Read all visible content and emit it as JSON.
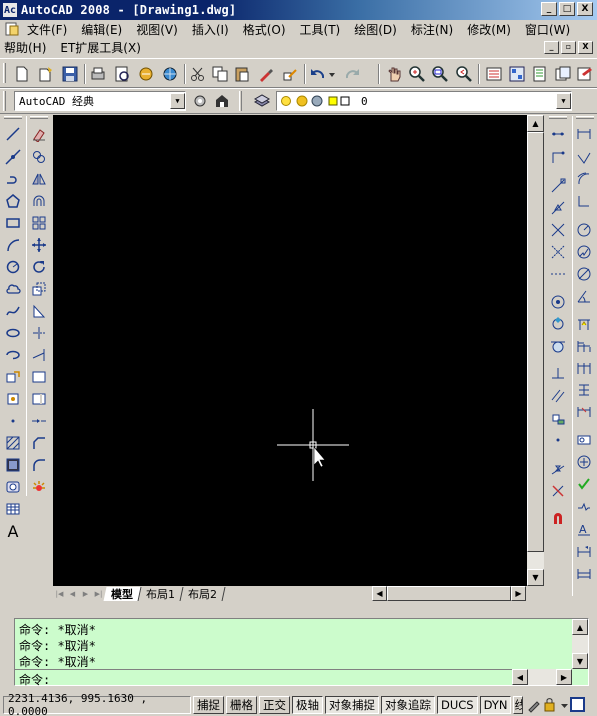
{
  "window": {
    "title": "AutoCAD 2008 - [Drawing1.dwg]",
    "app_icon_text": "Ac",
    "controls": [
      "_",
      "□",
      "X"
    ]
  },
  "menubar": {
    "items": [
      "文件(F)",
      "编辑(E)",
      "视图(V)",
      "插入(I)",
      "格式(O)",
      "工具(T)",
      "绘图(D)",
      "标注(N)",
      "修改(M)",
      "窗口(W)"
    ],
    "items_row2": [
      "帮助(H)",
      "ET扩展工具(X)"
    ],
    "mdi_controls": [
      "_",
      "▫",
      "X"
    ]
  },
  "workspace": {
    "selected": "AutoCAD 经典"
  },
  "layer": {
    "current": "0"
  },
  "layout_tabs": {
    "tabs": [
      "模型",
      "布局1",
      "布局2"
    ],
    "active": "模型"
  },
  "command": {
    "history": [
      "命令: *取消*",
      "命令: *取消*",
      "命令: *取消*"
    ],
    "prompt": "命令:"
  },
  "status": {
    "coordinates": "2231.4136, 995.1630 , 0.0000",
    "toggles": [
      "捕捉",
      "栅格",
      "正交",
      "极轴",
      "对象捕捉",
      "对象追踪",
      "DUCS",
      "DYN",
      "线"
    ]
  },
  "colors": {
    "title_start": "#0a246a",
    "title_end": "#a6caf0",
    "canvas_bg": "#000000",
    "command_bg": "#ccfccc",
    "chrome": "#d4d0c8"
  }
}
